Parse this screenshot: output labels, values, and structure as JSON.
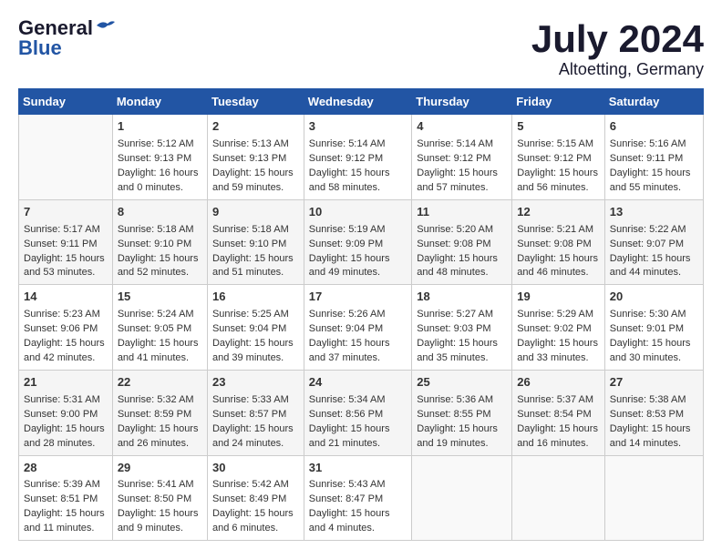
{
  "logo": {
    "general": "General",
    "blue": "Blue"
  },
  "title": "July 2024",
  "subtitle": "Altoetting, Germany",
  "days_header": [
    "Sunday",
    "Monday",
    "Tuesday",
    "Wednesday",
    "Thursday",
    "Friday",
    "Saturday"
  ],
  "weeks": [
    [
      {
        "day": "",
        "sunrise": "",
        "sunset": "",
        "daylight": ""
      },
      {
        "day": "1",
        "sunrise": "Sunrise: 5:12 AM",
        "sunset": "Sunset: 9:13 PM",
        "daylight": "Daylight: 16 hours and 0 minutes."
      },
      {
        "day": "2",
        "sunrise": "Sunrise: 5:13 AM",
        "sunset": "Sunset: 9:13 PM",
        "daylight": "Daylight: 15 hours and 59 minutes."
      },
      {
        "day": "3",
        "sunrise": "Sunrise: 5:14 AM",
        "sunset": "Sunset: 9:12 PM",
        "daylight": "Daylight: 15 hours and 58 minutes."
      },
      {
        "day": "4",
        "sunrise": "Sunrise: 5:14 AM",
        "sunset": "Sunset: 9:12 PM",
        "daylight": "Daylight: 15 hours and 57 minutes."
      },
      {
        "day": "5",
        "sunrise": "Sunrise: 5:15 AM",
        "sunset": "Sunset: 9:12 PM",
        "daylight": "Daylight: 15 hours and 56 minutes."
      },
      {
        "day": "6",
        "sunrise": "Sunrise: 5:16 AM",
        "sunset": "Sunset: 9:11 PM",
        "daylight": "Daylight: 15 hours and 55 minutes."
      }
    ],
    [
      {
        "day": "7",
        "sunrise": "Sunrise: 5:17 AM",
        "sunset": "Sunset: 9:11 PM",
        "daylight": "Daylight: 15 hours and 53 minutes."
      },
      {
        "day": "8",
        "sunrise": "Sunrise: 5:18 AM",
        "sunset": "Sunset: 9:10 PM",
        "daylight": "Daylight: 15 hours and 52 minutes."
      },
      {
        "day": "9",
        "sunrise": "Sunrise: 5:18 AM",
        "sunset": "Sunset: 9:10 PM",
        "daylight": "Daylight: 15 hours and 51 minutes."
      },
      {
        "day": "10",
        "sunrise": "Sunrise: 5:19 AM",
        "sunset": "Sunset: 9:09 PM",
        "daylight": "Daylight: 15 hours and 49 minutes."
      },
      {
        "day": "11",
        "sunrise": "Sunrise: 5:20 AM",
        "sunset": "Sunset: 9:08 PM",
        "daylight": "Daylight: 15 hours and 48 minutes."
      },
      {
        "day": "12",
        "sunrise": "Sunrise: 5:21 AM",
        "sunset": "Sunset: 9:08 PM",
        "daylight": "Daylight: 15 hours and 46 minutes."
      },
      {
        "day": "13",
        "sunrise": "Sunrise: 5:22 AM",
        "sunset": "Sunset: 9:07 PM",
        "daylight": "Daylight: 15 hours and 44 minutes."
      }
    ],
    [
      {
        "day": "14",
        "sunrise": "Sunrise: 5:23 AM",
        "sunset": "Sunset: 9:06 PM",
        "daylight": "Daylight: 15 hours and 42 minutes."
      },
      {
        "day": "15",
        "sunrise": "Sunrise: 5:24 AM",
        "sunset": "Sunset: 9:05 PM",
        "daylight": "Daylight: 15 hours and 41 minutes."
      },
      {
        "day": "16",
        "sunrise": "Sunrise: 5:25 AM",
        "sunset": "Sunset: 9:04 PM",
        "daylight": "Daylight: 15 hours and 39 minutes."
      },
      {
        "day": "17",
        "sunrise": "Sunrise: 5:26 AM",
        "sunset": "Sunset: 9:04 PM",
        "daylight": "Daylight: 15 hours and 37 minutes."
      },
      {
        "day": "18",
        "sunrise": "Sunrise: 5:27 AM",
        "sunset": "Sunset: 9:03 PM",
        "daylight": "Daylight: 15 hours and 35 minutes."
      },
      {
        "day": "19",
        "sunrise": "Sunrise: 5:29 AM",
        "sunset": "Sunset: 9:02 PM",
        "daylight": "Daylight: 15 hours and 33 minutes."
      },
      {
        "day": "20",
        "sunrise": "Sunrise: 5:30 AM",
        "sunset": "Sunset: 9:01 PM",
        "daylight": "Daylight: 15 hours and 30 minutes."
      }
    ],
    [
      {
        "day": "21",
        "sunrise": "Sunrise: 5:31 AM",
        "sunset": "Sunset: 9:00 PM",
        "daylight": "Daylight: 15 hours and 28 minutes."
      },
      {
        "day": "22",
        "sunrise": "Sunrise: 5:32 AM",
        "sunset": "Sunset: 8:59 PM",
        "daylight": "Daylight: 15 hours and 26 minutes."
      },
      {
        "day": "23",
        "sunrise": "Sunrise: 5:33 AM",
        "sunset": "Sunset: 8:57 PM",
        "daylight": "Daylight: 15 hours and 24 minutes."
      },
      {
        "day": "24",
        "sunrise": "Sunrise: 5:34 AM",
        "sunset": "Sunset: 8:56 PM",
        "daylight": "Daylight: 15 hours and 21 minutes."
      },
      {
        "day": "25",
        "sunrise": "Sunrise: 5:36 AM",
        "sunset": "Sunset: 8:55 PM",
        "daylight": "Daylight: 15 hours and 19 minutes."
      },
      {
        "day": "26",
        "sunrise": "Sunrise: 5:37 AM",
        "sunset": "Sunset: 8:54 PM",
        "daylight": "Daylight: 15 hours and 16 minutes."
      },
      {
        "day": "27",
        "sunrise": "Sunrise: 5:38 AM",
        "sunset": "Sunset: 8:53 PM",
        "daylight": "Daylight: 15 hours and 14 minutes."
      }
    ],
    [
      {
        "day": "28",
        "sunrise": "Sunrise: 5:39 AM",
        "sunset": "Sunset: 8:51 PM",
        "daylight": "Daylight: 15 hours and 11 minutes."
      },
      {
        "day": "29",
        "sunrise": "Sunrise: 5:41 AM",
        "sunset": "Sunset: 8:50 PM",
        "daylight": "Daylight: 15 hours and 9 minutes."
      },
      {
        "day": "30",
        "sunrise": "Sunrise: 5:42 AM",
        "sunset": "Sunset: 8:49 PM",
        "daylight": "Daylight: 15 hours and 6 minutes."
      },
      {
        "day": "31",
        "sunrise": "Sunrise: 5:43 AM",
        "sunset": "Sunset: 8:47 PM",
        "daylight": "Daylight: 15 hours and 4 minutes."
      },
      {
        "day": "",
        "sunrise": "",
        "sunset": "",
        "daylight": ""
      },
      {
        "day": "",
        "sunrise": "",
        "sunset": "",
        "daylight": ""
      },
      {
        "day": "",
        "sunrise": "",
        "sunset": "",
        "daylight": ""
      }
    ]
  ]
}
